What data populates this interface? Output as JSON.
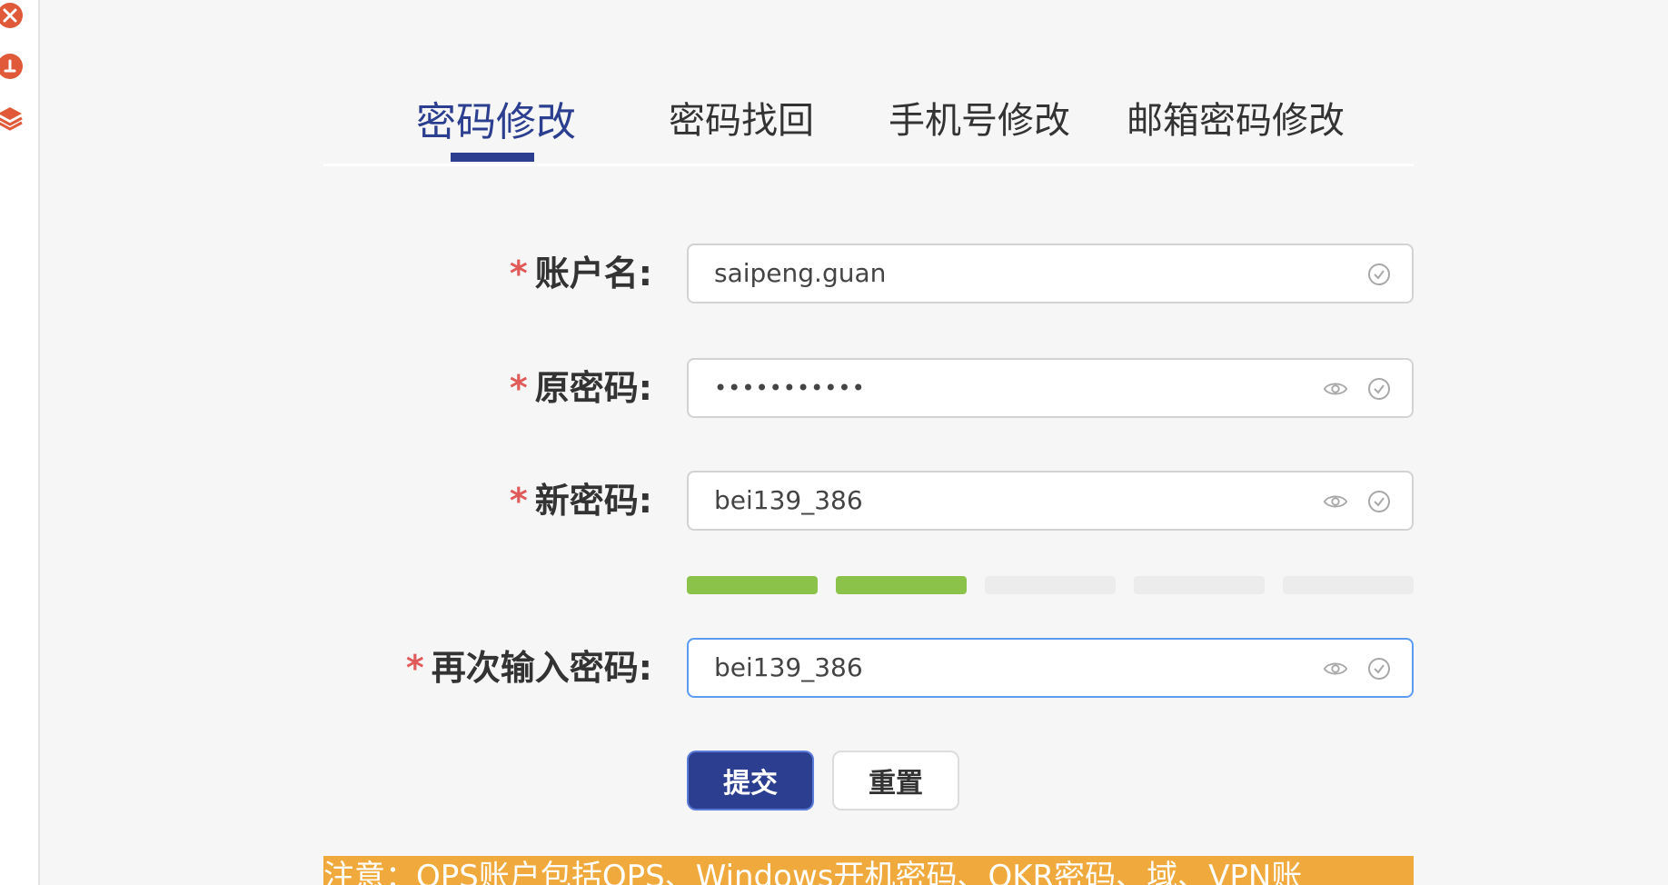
{
  "rail": {
    "icons": [
      "tools-icon",
      "user-upload-icon",
      "layers-icon"
    ],
    "accent": "#e05a3a"
  },
  "tabs": [
    {
      "label": "密码修改",
      "active": true
    },
    {
      "label": "密码找回",
      "active": false
    },
    {
      "label": "手机号修改",
      "active": false
    },
    {
      "label": "邮箱密码修改",
      "active": false
    }
  ],
  "form": {
    "required_mark": "*",
    "account": {
      "label": "账户名:",
      "value": "saipeng.guan"
    },
    "old_password": {
      "label": "原密码:",
      "value": "•••••••••••"
    },
    "new_password": {
      "label": "新密码:",
      "value": "bei139_386"
    },
    "confirm_password": {
      "label": "再次输入密码:",
      "value": "bei139_386"
    }
  },
  "strength": {
    "level": 2,
    "total": 5,
    "on_color": "#8bc34a",
    "off_color": "#ececec"
  },
  "buttons": {
    "submit": "提交",
    "reset": "重置"
  },
  "notice": {
    "text": "注意：OPS账户包括OPS、Windows开机密码、OKR密码、域、VPN账"
  },
  "colors": {
    "primary": "#2c3e8f",
    "required": "#e05a5a",
    "focus": "#5b9bf0",
    "notice_bg": "#f0a93c"
  }
}
